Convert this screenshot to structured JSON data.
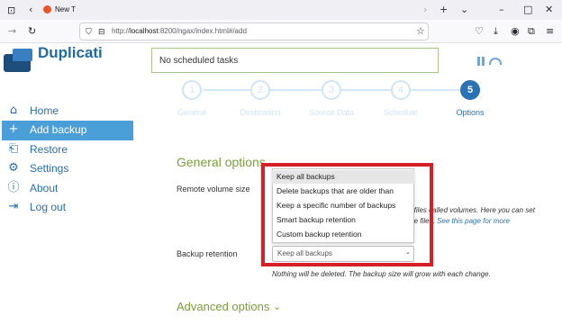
{
  "browser": {
    "tab_title": "New T",
    "url_prefix": "http://",
    "url_host": "localhost",
    "url_rest": ":8200/ngax/index.html#/add"
  },
  "app": {
    "title": "Duplicati",
    "status": "No scheduled tasks"
  },
  "sidebar": {
    "items": [
      {
        "label": "Home",
        "icon": "home-icon"
      },
      {
        "label": "Add backup",
        "icon": "plus-icon",
        "active": true
      },
      {
        "label": "Restore",
        "icon": "restore-icon"
      },
      {
        "label": "Settings",
        "icon": "gear-icon"
      },
      {
        "label": "About",
        "icon": "info-icon"
      },
      {
        "label": "Log out",
        "icon": "logout-icon"
      }
    ]
  },
  "steps": [
    {
      "number": "1",
      "label": "General"
    },
    {
      "number": "2",
      "label": "Destination"
    },
    {
      "number": "3",
      "label": "Source Data"
    },
    {
      "number": "4",
      "label": "Schedule"
    },
    {
      "number": "5",
      "label": "Options",
      "active": true
    }
  ],
  "general_options": {
    "heading": "General options",
    "remote_volume_label": "Remote volume size",
    "desc_part1": "e files called volumes. Here you can set",
    "desc_part2": "me files.",
    "desc_link": "See this page for more",
    "backup_retention_label": "Backup retention",
    "retention_value": "Keep all backups",
    "retention_note": "Nothing will be deleted. The backup size will grow with each change."
  },
  "retention_options": [
    "Keep all backups",
    "Delete backups that are older than",
    "Keep a specific number of backups",
    "Smart backup retention",
    "Custom backup retention"
  ],
  "advanced_options": {
    "heading": "Advanced options"
  },
  "colors": {
    "accent_blue": "#2a72b3",
    "active_nav": "#4a9fd8",
    "heading_green": "#7a9e3b",
    "highlight_red": "#d42026"
  }
}
